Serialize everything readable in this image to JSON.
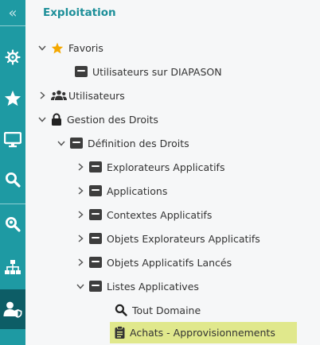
{
  "sidebar": {
    "collapse_icon": "«",
    "items": [
      {
        "name": "helm-icon"
      },
      {
        "name": "star-icon"
      },
      {
        "name": "monitor-icon"
      },
      {
        "name": "search-icon"
      },
      {
        "name": "location-search-icon"
      },
      {
        "name": "org-chart-icon"
      },
      {
        "name": "user-shield-icon",
        "active": true
      }
    ],
    "colors": {
      "background": "#1e9aa3",
      "active": "#0d5d66"
    }
  },
  "panel": {
    "title": "Exploitation",
    "tree": {
      "favoris": "Favoris",
      "utilisateurs_diapason": "Utilisateurs sur DIAPASON",
      "utilisateurs": "Utilisateurs",
      "gestion_droits": "Gestion des Droits",
      "definition_droits": "Définition des Droits",
      "explorateurs_applicatifs": "Explorateurs Applicatifs",
      "applications": "Applications",
      "contextes_applicatifs": "Contextes Applicatifs",
      "objets_explorateurs": "Objets Explorateurs Applicatifs",
      "objets_lances": "Objets Applicatifs Lancés",
      "listes_applicatives": "Listes Applicatives",
      "tout_domaine": "Tout Domaine",
      "achats": "Achats - Approvisionnements"
    },
    "colors": {
      "title": "#1d8f99",
      "selected": "#e0e88c",
      "star": "#f4a800"
    }
  }
}
